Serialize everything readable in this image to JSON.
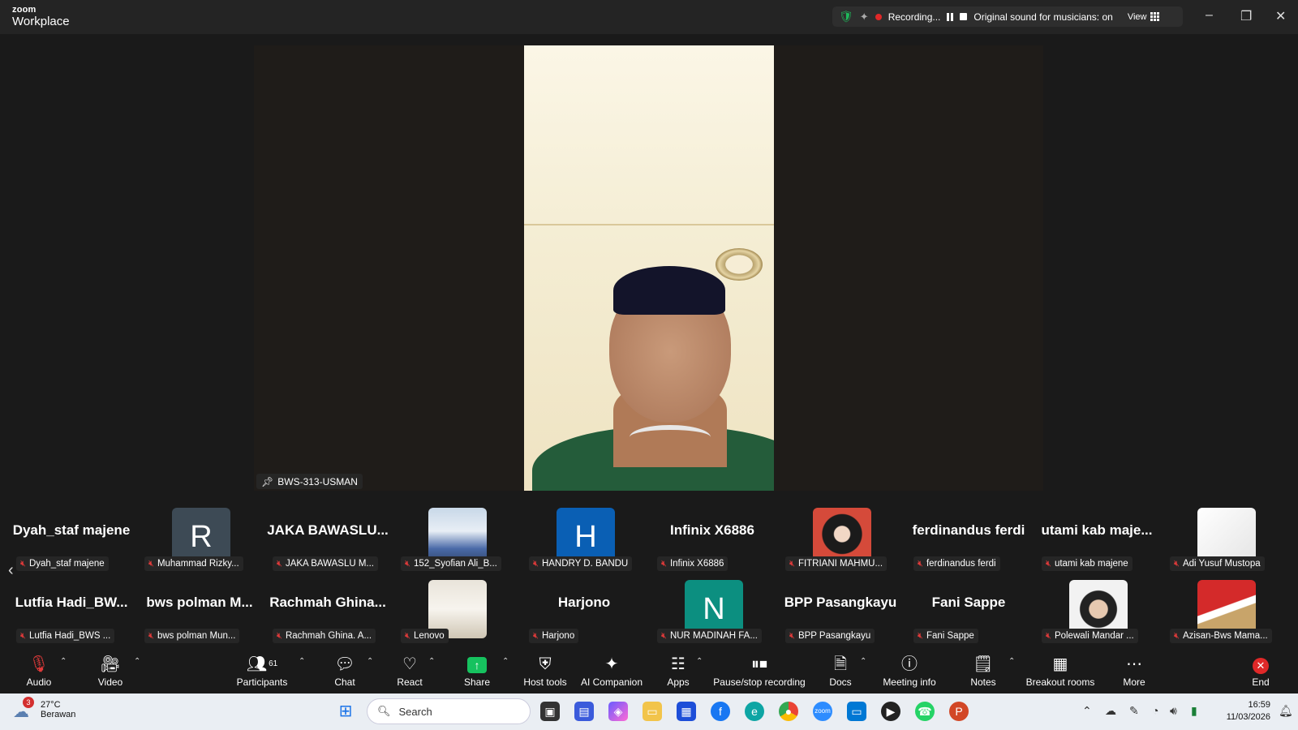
{
  "app": {
    "brand_top": "zoom",
    "brand_bottom": "Workplace"
  },
  "status": {
    "recording": "Recording...",
    "sound": "Original sound for musicians: on",
    "view": "View"
  },
  "main_video": {
    "label": "BWS-313-USMAN"
  },
  "gallery": {
    "row1": [
      {
        "big": "Dyah_staf majene",
        "label": "Dyah_staf majene"
      },
      {
        "avatar": "R",
        "color": "#3d4a55",
        "label": "Muhammad Rizky..."
      },
      {
        "big": "JAKA BAWASLU...",
        "label": "JAKA BAWASLU M..."
      },
      {
        "photo": true,
        "label": "152_Syofian Ali_B..."
      },
      {
        "avatar": "H",
        "color": "#0a5fb4",
        "label": "HANDRY D. BANDU"
      },
      {
        "big": "Infinix X6886",
        "label": "Infinix X6886"
      },
      {
        "photo": true,
        "label": "FITRIANI MAHMU..."
      },
      {
        "big": "ferdinandus ferdi",
        "label": "ferdinandus ferdi"
      },
      {
        "big": "utami kab maje...",
        "label": "utami kab majene"
      },
      {
        "photo": true,
        "label": "Adi Yusuf Mustopa"
      }
    ],
    "row2": [
      {
        "big": "Lutfia Hadi_BW...",
        "label": "Lutfia Hadi_BWS ..."
      },
      {
        "big": "bws polman M...",
        "label": "bws polman Mun..."
      },
      {
        "big": "Rachmah Ghina...",
        "label": "Rachmah Ghina. A..."
      },
      {
        "photo": true,
        "label": "Lenovo"
      },
      {
        "big": "Harjono",
        "label": "Harjono"
      },
      {
        "avatar": "N",
        "color": "#0c8f80",
        "label": "NUR MADINAH FA..."
      },
      {
        "big": "BPP Pasangkayu",
        "label": "BPP Pasangkayu"
      },
      {
        "big": "Fani Sappe",
        "label": "Fani Sappe"
      },
      {
        "photo": true,
        "label": "Polewali Mandar ..."
      },
      {
        "photo": true,
        "label": "Azisan-Bws Mama..."
      }
    ]
  },
  "toolbar": {
    "audio": "Audio",
    "video": "Video",
    "participants": "Participants",
    "participants_count": "61",
    "chat": "Chat",
    "react": "React",
    "share": "Share",
    "host_tools": "Host tools",
    "ai_companion": "AI Companion",
    "apps": "Apps",
    "pause_stop": "Pause/stop recording",
    "docs": "Docs",
    "meeting_info": "Meeting info",
    "notes": "Notes",
    "breakout": "Breakout rooms",
    "more": "More",
    "end": "End"
  },
  "taskbar": {
    "weather_temp": "27°C",
    "weather_desc": "Berawan",
    "weather_badge": "3",
    "search": "Search",
    "time": "16:59",
    "date": "11/03/2026"
  }
}
